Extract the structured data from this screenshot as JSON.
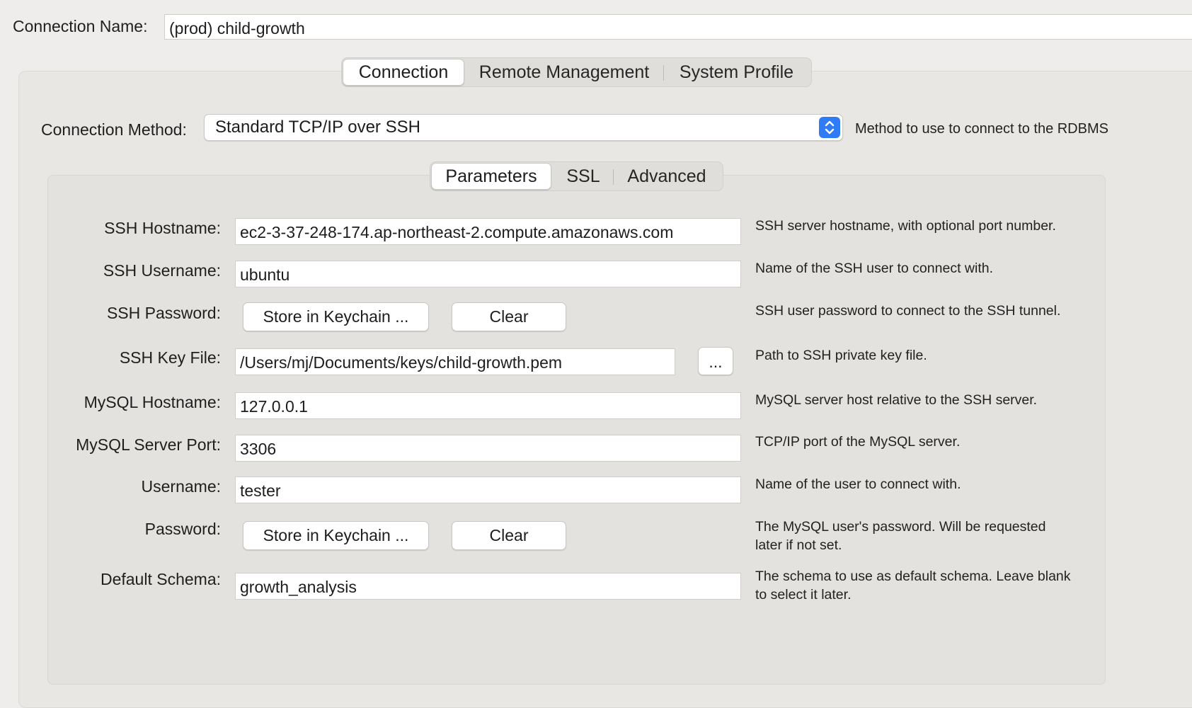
{
  "connection_name": {
    "label": "Connection Name:",
    "value": "(prod) child-growth"
  },
  "main_tabs": {
    "connection": "Connection",
    "remote_management": "Remote Management",
    "system_profile": "System Profile"
  },
  "method": {
    "label": "Connection Method:",
    "value": "Standard TCP/IP over SSH",
    "help": "Method to use to connect to the RDBMS"
  },
  "sub_tabs": {
    "parameters": "Parameters",
    "ssl": "SSL",
    "advanced": "Advanced"
  },
  "fields": {
    "ssh_hostname": {
      "label": "SSH Hostname:",
      "value": "ec2-3-37-248-174.ap-northeast-2.compute.amazonaws.com",
      "help": "SSH server hostname, with  optional port number."
    },
    "ssh_username": {
      "label": "SSH Username:",
      "value": "ubuntu",
      "help": "Name of the SSH user to connect with."
    },
    "ssh_password": {
      "label": "SSH Password:",
      "store": "Store in Keychain ...",
      "clear": "Clear",
      "help": "SSH user password to connect to the SSH tunnel."
    },
    "ssh_key_file": {
      "label": "SSH Key File:",
      "value": "/Users/mj/Documents/keys/child-growth.pem",
      "browse": "...",
      "help": "Path to SSH private key file."
    },
    "mysql_hostname": {
      "label": "MySQL Hostname:",
      "value": "127.0.0.1",
      "help": "MySQL server host relative to the SSH server."
    },
    "mysql_port": {
      "label": "MySQL Server Port:",
      "value": "3306",
      "help": "TCP/IP port of the MySQL server."
    },
    "username": {
      "label": "Username:",
      "value": "tester",
      "help": "Name of the user to connect with."
    },
    "password": {
      "label": "Password:",
      "store": "Store in Keychain ...",
      "clear": "Clear",
      "help1": "The MySQL user's password. Will be requested",
      "help2": "later if not set."
    },
    "default_schema": {
      "label": "Default Schema:",
      "value": "growth_analysis",
      "help1": "The schema to use as default schema. Leave blank",
      "help2": "to select it later."
    }
  },
  "colors": {
    "accent": "#2f7cf6",
    "background": "#efedeb",
    "panel": "#e9e7e4"
  }
}
